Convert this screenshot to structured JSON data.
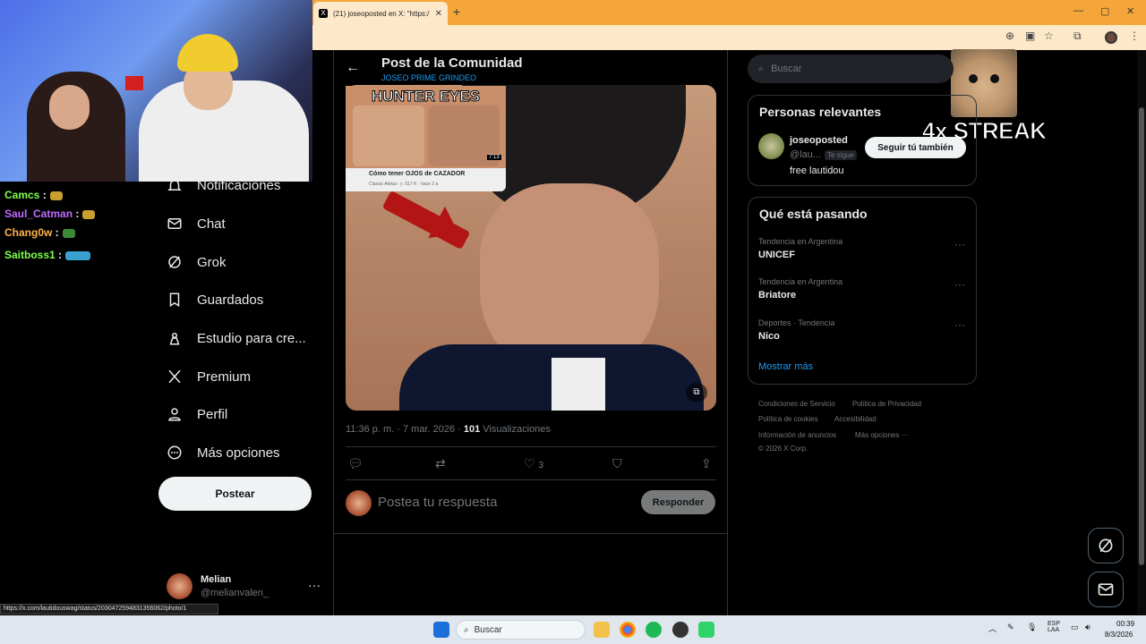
{
  "browser": {
    "tab_title": "(21) joseoposted en X: \"https:/",
    "tab_icon": "X",
    "new_tab": "+",
    "min": "—",
    "max": "▢",
    "close": "✕"
  },
  "stream": {
    "chat": [
      {
        "user": "Camcs",
        "color": "#7fff4a"
      },
      {
        "user": "Saul_Catman",
        "color": "#c06bff"
      },
      {
        "user": "Chang0w",
        "color": "#ffb347"
      },
      {
        "user": "Saitboss1",
        "color": "#7fff4a"
      }
    ],
    "streak": "4x STREAK",
    "status_url": "https://x.com/lautidouswag/status/2030472594831356062/photo/1"
  },
  "nav": {
    "items": [
      {
        "label": "Notificaciones",
        "icon": "bell-icon"
      },
      {
        "label": "Chat",
        "icon": "mail-icon"
      },
      {
        "label": "Grok",
        "icon": "grok-icon"
      },
      {
        "label": "Guardados",
        "icon": "bookmark-icon"
      },
      {
        "label": "Estudio para cre...",
        "icon": "studio-icon"
      },
      {
        "label": "Premium",
        "icon": "x-icon"
      },
      {
        "label": "Perfil",
        "icon": "person-icon"
      },
      {
        "label": "Más opciones",
        "icon": "more-circle-icon"
      }
    ],
    "post_label": "Postear",
    "user": {
      "name": "Melian",
      "handle": "@melianvalen_"
    }
  },
  "post": {
    "title": "Post de la Comunidad",
    "subtitle": "JOSEO PRIME GRINDEO",
    "thumb": {
      "headline": "HUNTER EYES",
      "caption": "Cómo tener OJOS de CAZADOR",
      "meta": "Classic Alekai · ▷ 517 K · hace 2 a",
      "duration": "7:13"
    },
    "time": "11:36 p. m. · 7 mar. 2026 · ",
    "views_count": "101",
    "views_label": " Visualizaciones",
    "likes": "3",
    "reply_placeholder": "Postea tu respuesta",
    "reply_button": "Responder"
  },
  "sidebar": {
    "search_placeholder": "Buscar",
    "relevant_title": "Personas relevantes",
    "relevant": {
      "name": "joseoposted",
      "handle": "@lau...",
      "badge": "Te sigue",
      "bio": "free lautidou",
      "button": "Seguir tú también"
    },
    "trends_title": "Qué está pasando",
    "trends": [
      {
        "context": "Tendencia en Argentina",
        "name": "UNICEF"
      },
      {
        "context": "Tendencia en Argentina",
        "name": "Briatore"
      },
      {
        "context": "Deportes · Tendencia",
        "name": "Nico"
      }
    ],
    "show_more": "Mostrar más",
    "footer": {
      "terms": "Condiciones de Servicio",
      "privacy": "Política de Privacidad",
      "cookies": "Política de cookies",
      "access": "Accesibilidad",
      "ads": "Información de anuncios",
      "more": "Más opciones ···",
      "copyright": "© 2026 X Corp."
    }
  },
  "taskbar": {
    "search": "Buscar",
    "lang1": "ESP",
    "lang2": "LAA",
    "time": "00:39",
    "date": "8/3/2026"
  },
  "colors": {
    "accent": "#1d9bf0",
    "tabbar": "#f4a63a",
    "background": "#000000"
  }
}
